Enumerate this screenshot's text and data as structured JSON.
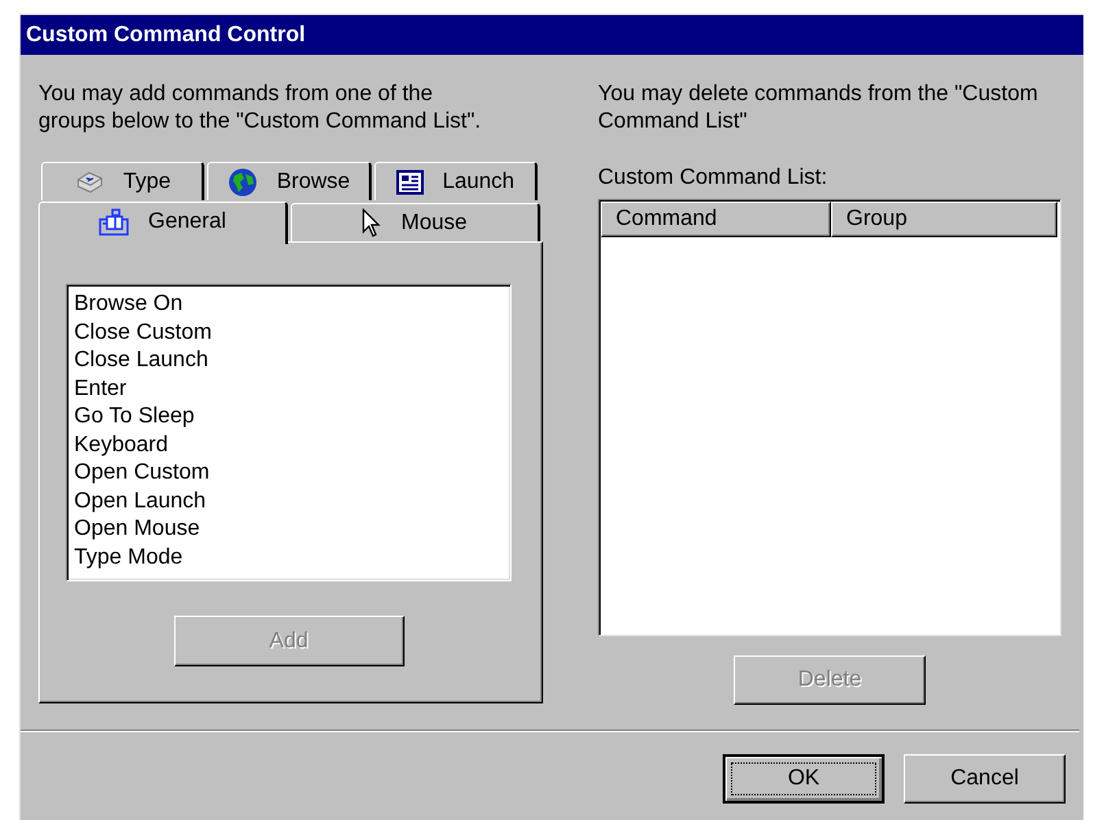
{
  "window": {
    "title": "Custom Command Control"
  },
  "add_panel": {
    "instructions": "You may add commands from one of the groups below to the \"Custom Command List\".",
    "tab_rows": [
      {
        "tabs": [
          {
            "label": "Type",
            "selected": false
          },
          {
            "label": "Browse",
            "selected": false
          },
          {
            "label": "Launch",
            "selected": false
          }
        ]
      },
      {
        "tabs": [
          {
            "label": "General",
            "selected": true
          },
          {
            "label": "Mouse",
            "selected": false
          }
        ]
      }
    ],
    "commands": [
      "Browse On",
      "Close Custom",
      "Close Launch",
      "Enter",
      "Go To Sleep",
      "Keyboard",
      "Open Custom",
      "Open Launch",
      "Open Mouse",
      "Type Mode"
    ],
    "add_button": {
      "label": "Add",
      "disabled": true
    }
  },
  "delete_panel": {
    "instructions": "You may delete commands from the \"Custom Command List\"",
    "list_label": "Custom Command List:",
    "columns": [
      "Command",
      "Group"
    ],
    "delete_button": {
      "label": "Delete",
      "disabled": true
    }
  },
  "buttons": [
    {
      "label": "OK",
      "default": true
    },
    {
      "label": "Cancel",
      "default": false
    }
  ]
}
